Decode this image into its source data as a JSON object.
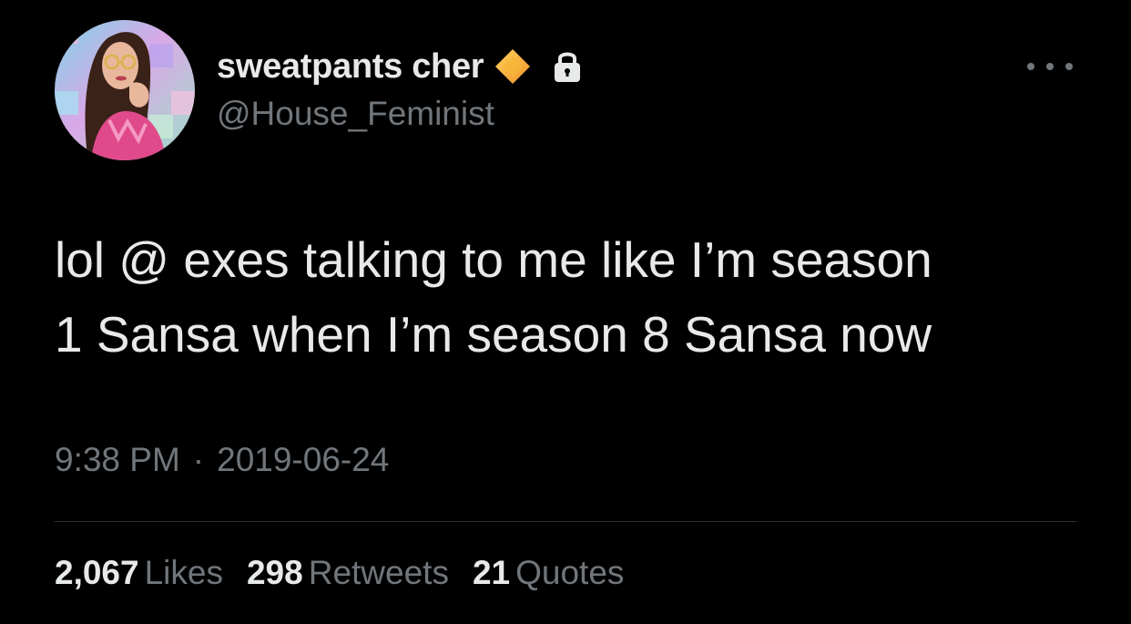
{
  "user": {
    "display_name": "sweatpants cher",
    "handle": "@House_Feminist",
    "verified_icon": "diamond-badge-icon",
    "protected_icon": "lock-icon"
  },
  "tweet": {
    "text": "lol @ exes talking to me like I’m season\n1 Sansa when I’m season 8 Sansa now",
    "time": "9:38 PM",
    "separator": "·",
    "date": "2019-06-24"
  },
  "stats": {
    "likes_count": "2,067",
    "likes_label": "Likes",
    "retweets_count": "298",
    "retweets_label": "Retweets",
    "quotes_count": "21",
    "quotes_label": "Quotes"
  },
  "colors": {
    "background": "#000000",
    "primary_text": "#e7e9ea",
    "secondary_text": "#71767b",
    "divider": "#2f3336",
    "badge_gold": "#f5a623"
  }
}
